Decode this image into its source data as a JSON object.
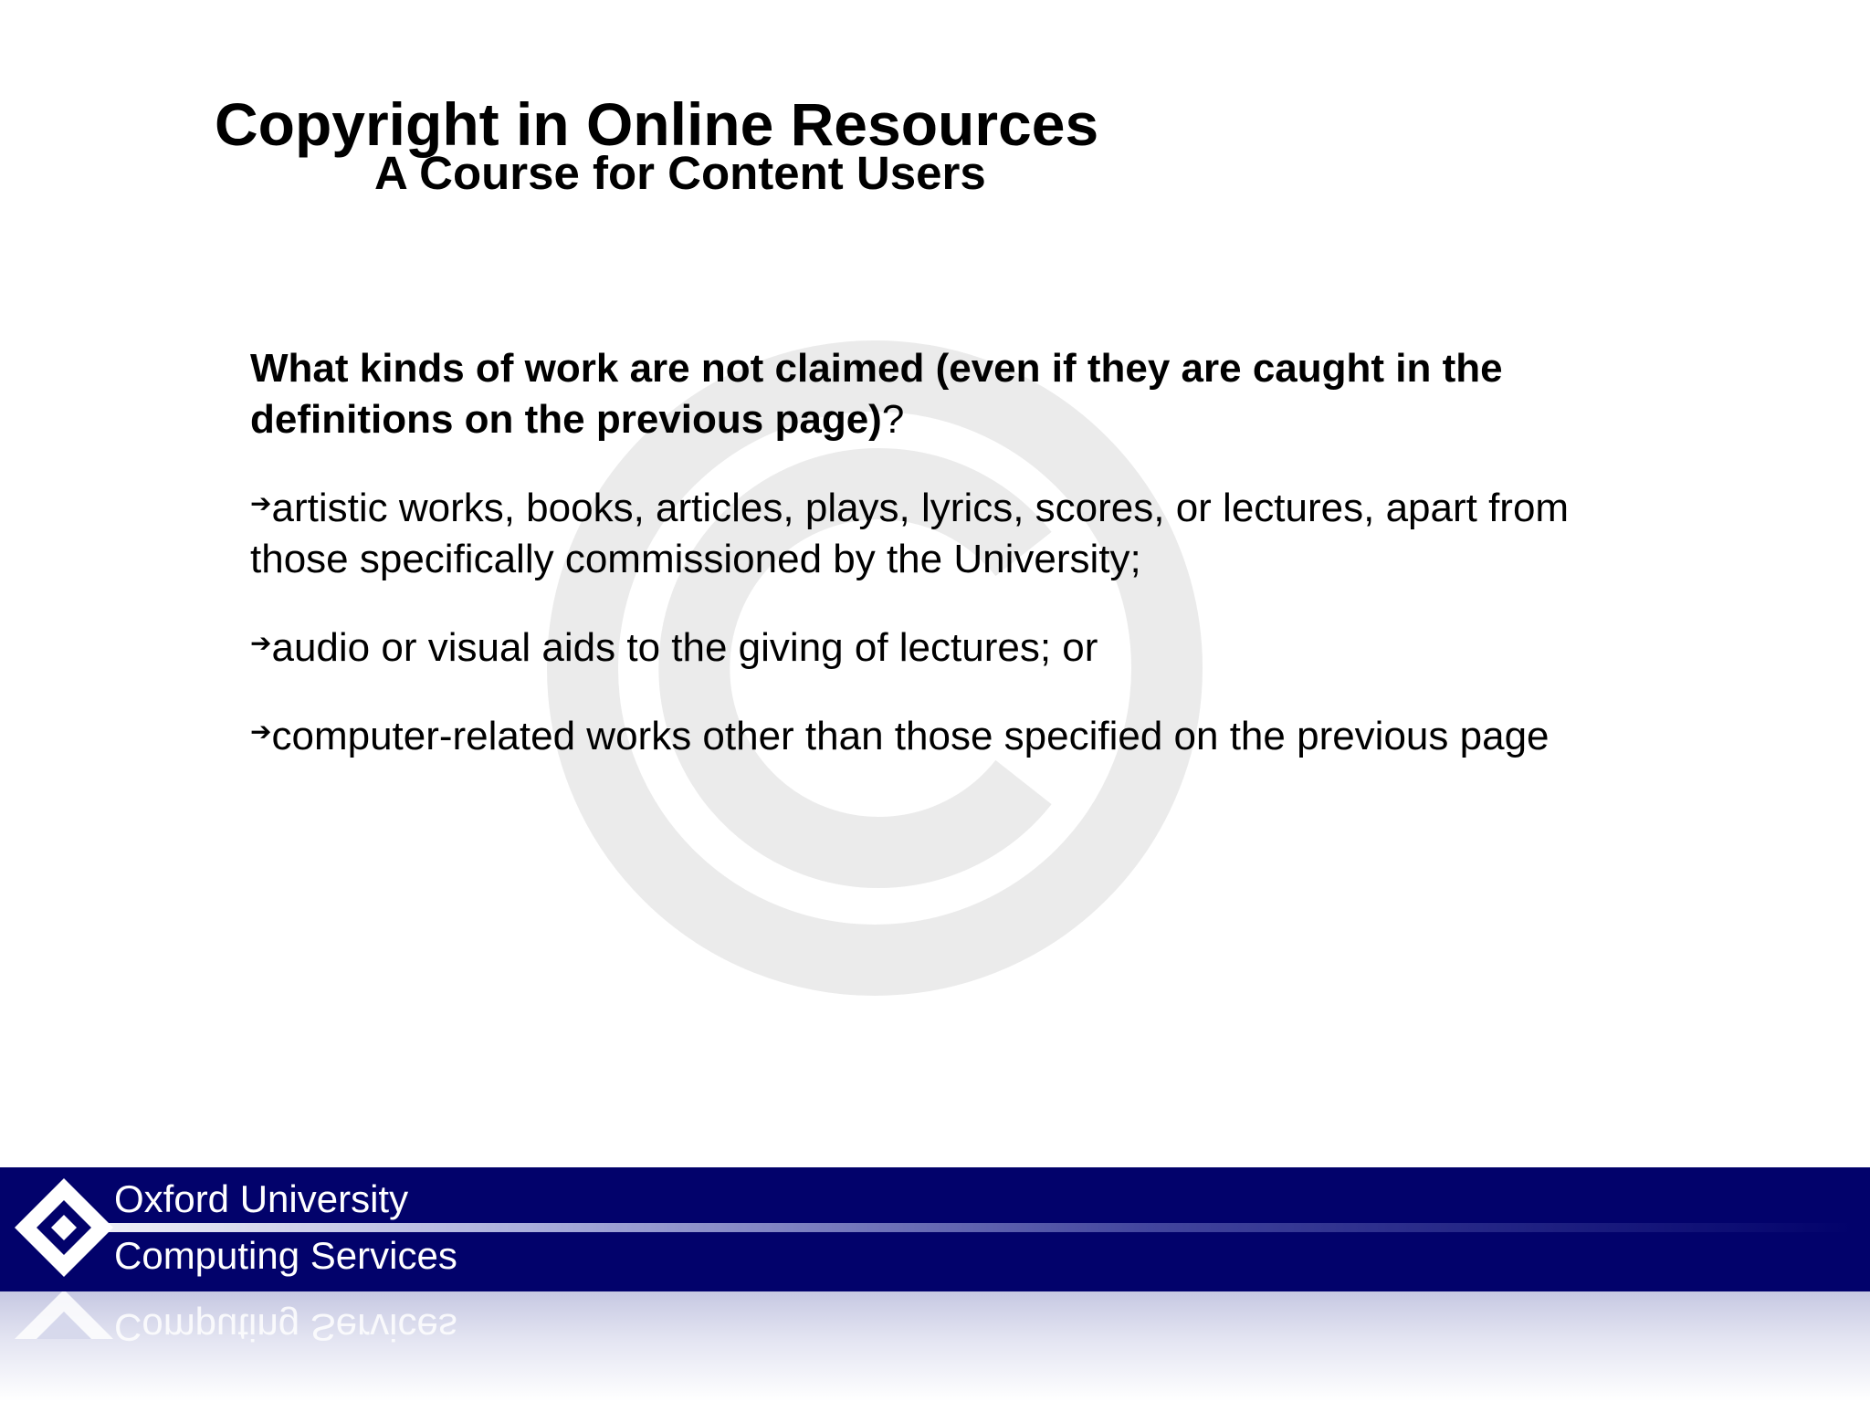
{
  "slide": {
    "title": "Copyright in Online Resources",
    "subtitle": "A Course for Content Users",
    "question_bold": "What kinds of work are not claimed (even if they are caught in the definitions on the previous page)",
    "question_tail": "?",
    "bullet_glyph": "➔",
    "bullets": [
      "artistic works, books, articles, plays, lyrics, scores, or lectures, apart from those specifically commissioned by the University;",
      "audio or visual aids to the giving of lectures; or",
      "computer-related works other than those specified on the previous page"
    ]
  },
  "footer": {
    "line1": "Oxford University",
    "line2": "Computing Services",
    "band_color": "#02026b"
  },
  "watermark": {
    "icon": "copyright-icon",
    "color": "#ebebeb"
  }
}
